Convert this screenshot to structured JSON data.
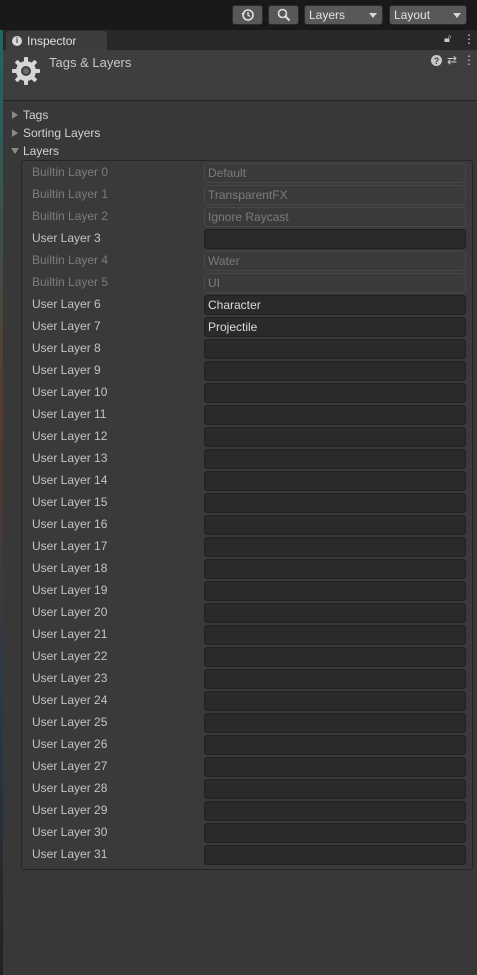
{
  "toolbar": {
    "history_icon": "history-icon",
    "search_icon": "search-icon",
    "layers_dropdown": "Layers",
    "layout_dropdown": "Layout"
  },
  "tab": {
    "label": "Inspector",
    "icon": "info-icon",
    "lock_icon": "lock-icon",
    "more_icon": "kebab-menu-icon"
  },
  "header": {
    "title": "Tags & Layers",
    "icon": "gear-icon"
  },
  "sections": {
    "tags": "Tags",
    "sorting_layers": "Sorting Layers",
    "layers": "Layers"
  },
  "layers": [
    {
      "label": "Builtin Layer 0",
      "value": "Default",
      "builtin": true
    },
    {
      "label": "Builtin Layer 1",
      "value": "TransparentFX",
      "builtin": true
    },
    {
      "label": "Builtin Layer 2",
      "value": "Ignore Raycast",
      "builtin": true
    },
    {
      "label": "User Layer 3",
      "value": "",
      "builtin": false
    },
    {
      "label": "Builtin Layer 4",
      "value": "Water",
      "builtin": true
    },
    {
      "label": "Builtin Layer 5",
      "value": "UI",
      "builtin": true
    },
    {
      "label": "User Layer 6",
      "value": "Character",
      "builtin": false
    },
    {
      "label": "User Layer 7",
      "value": "Projectile",
      "builtin": false
    },
    {
      "label": "User Layer 8",
      "value": "",
      "builtin": false
    },
    {
      "label": "User Layer 9",
      "value": "",
      "builtin": false
    },
    {
      "label": "User Layer 10",
      "value": "",
      "builtin": false
    },
    {
      "label": "User Layer 11",
      "value": "",
      "builtin": false
    },
    {
      "label": "User Layer 12",
      "value": "",
      "builtin": false
    },
    {
      "label": "User Layer 13",
      "value": "",
      "builtin": false
    },
    {
      "label": "User Layer 14",
      "value": "",
      "builtin": false
    },
    {
      "label": "User Layer 15",
      "value": "",
      "builtin": false
    },
    {
      "label": "User Layer 16",
      "value": "",
      "builtin": false
    },
    {
      "label": "User Layer 17",
      "value": "",
      "builtin": false
    },
    {
      "label": "User Layer 18",
      "value": "",
      "builtin": false
    },
    {
      "label": "User Layer 19",
      "value": "",
      "builtin": false
    },
    {
      "label": "User Layer 20",
      "value": "",
      "builtin": false
    },
    {
      "label": "User Layer 21",
      "value": "",
      "builtin": false
    },
    {
      "label": "User Layer 22",
      "value": "",
      "builtin": false
    },
    {
      "label": "User Layer 23",
      "value": "",
      "builtin": false
    },
    {
      "label": "User Layer 24",
      "value": "",
      "builtin": false
    },
    {
      "label": "User Layer 25",
      "value": "",
      "builtin": false
    },
    {
      "label": "User Layer 26",
      "value": "",
      "builtin": false
    },
    {
      "label": "User Layer 27",
      "value": "",
      "builtin": false
    },
    {
      "label": "User Layer 28",
      "value": "",
      "builtin": false
    },
    {
      "label": "User Layer 29",
      "value": "",
      "builtin": false
    },
    {
      "label": "User Layer 30",
      "value": "",
      "builtin": false
    },
    {
      "label": "User Layer 31",
      "value": "",
      "builtin": false
    }
  ],
  "colors": {
    "panel_bg": "#383838",
    "toolbar_bg": "#191919",
    "field_bg": "#2a2a2a",
    "disabled_text": "#7c7c7c"
  }
}
